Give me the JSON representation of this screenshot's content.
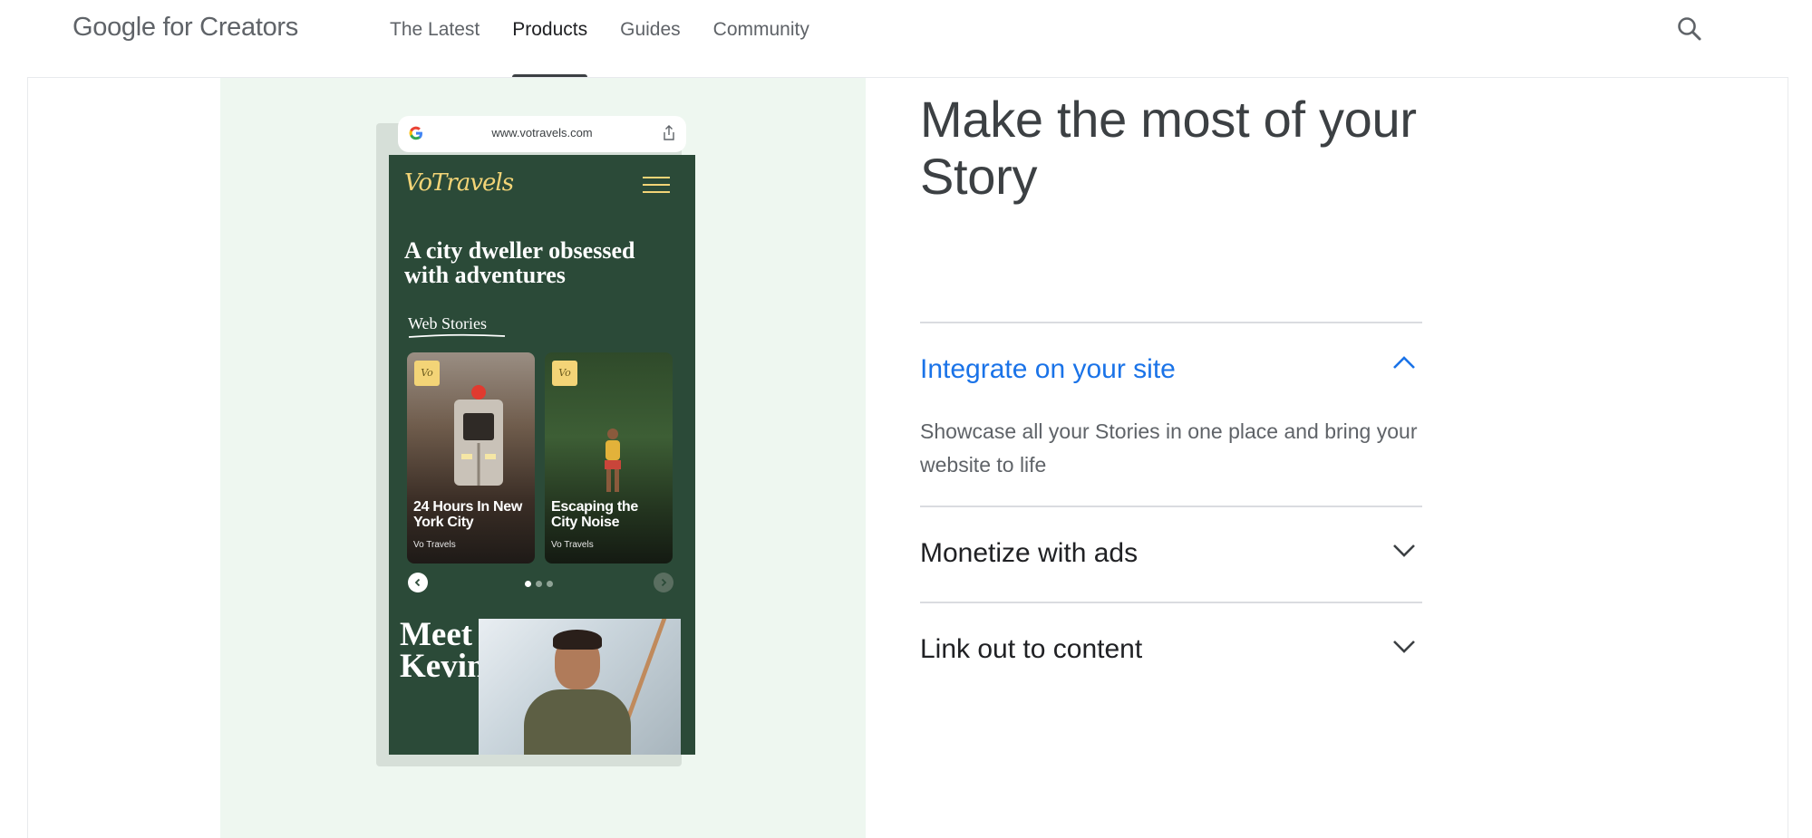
{
  "header": {
    "logo": "Google for Creators",
    "nav": [
      {
        "label": "The Latest",
        "active": false
      },
      {
        "label": "Products",
        "active": true
      },
      {
        "label": "Guides",
        "active": false
      },
      {
        "label": "Community",
        "active": false
      }
    ],
    "search_icon": "search-icon"
  },
  "phone": {
    "url": "www.votravels.com",
    "site_logo": "VoTravels",
    "headline": "A city dweller obsessed with adventures",
    "section_label": "Web Stories",
    "stories": [
      {
        "title": "24 Hours In New York City",
        "author": "Vo Travels",
        "badge": "Vo"
      },
      {
        "title": "Escaping the City Noise",
        "author": "Vo Travels",
        "badge": "Vo"
      }
    ],
    "carousel": {
      "pages": 3,
      "current": 1
    },
    "meet": "Meet Kevin"
  },
  "main": {
    "heading": "Make the most of your Story",
    "accordion": [
      {
        "title": "Integrate on your site",
        "expanded": true,
        "body": "Showcase all your Stories in one place and bring your website to life"
      },
      {
        "title": "Monetize with ads",
        "expanded": false
      },
      {
        "title": "Link out to content",
        "expanded": false
      }
    ]
  },
  "colors": {
    "accent_blue": "#1a73e8",
    "mint_panel": "#eef7f0",
    "phone_green": "#2b4a38",
    "brand_yellow": "#f3d477"
  }
}
